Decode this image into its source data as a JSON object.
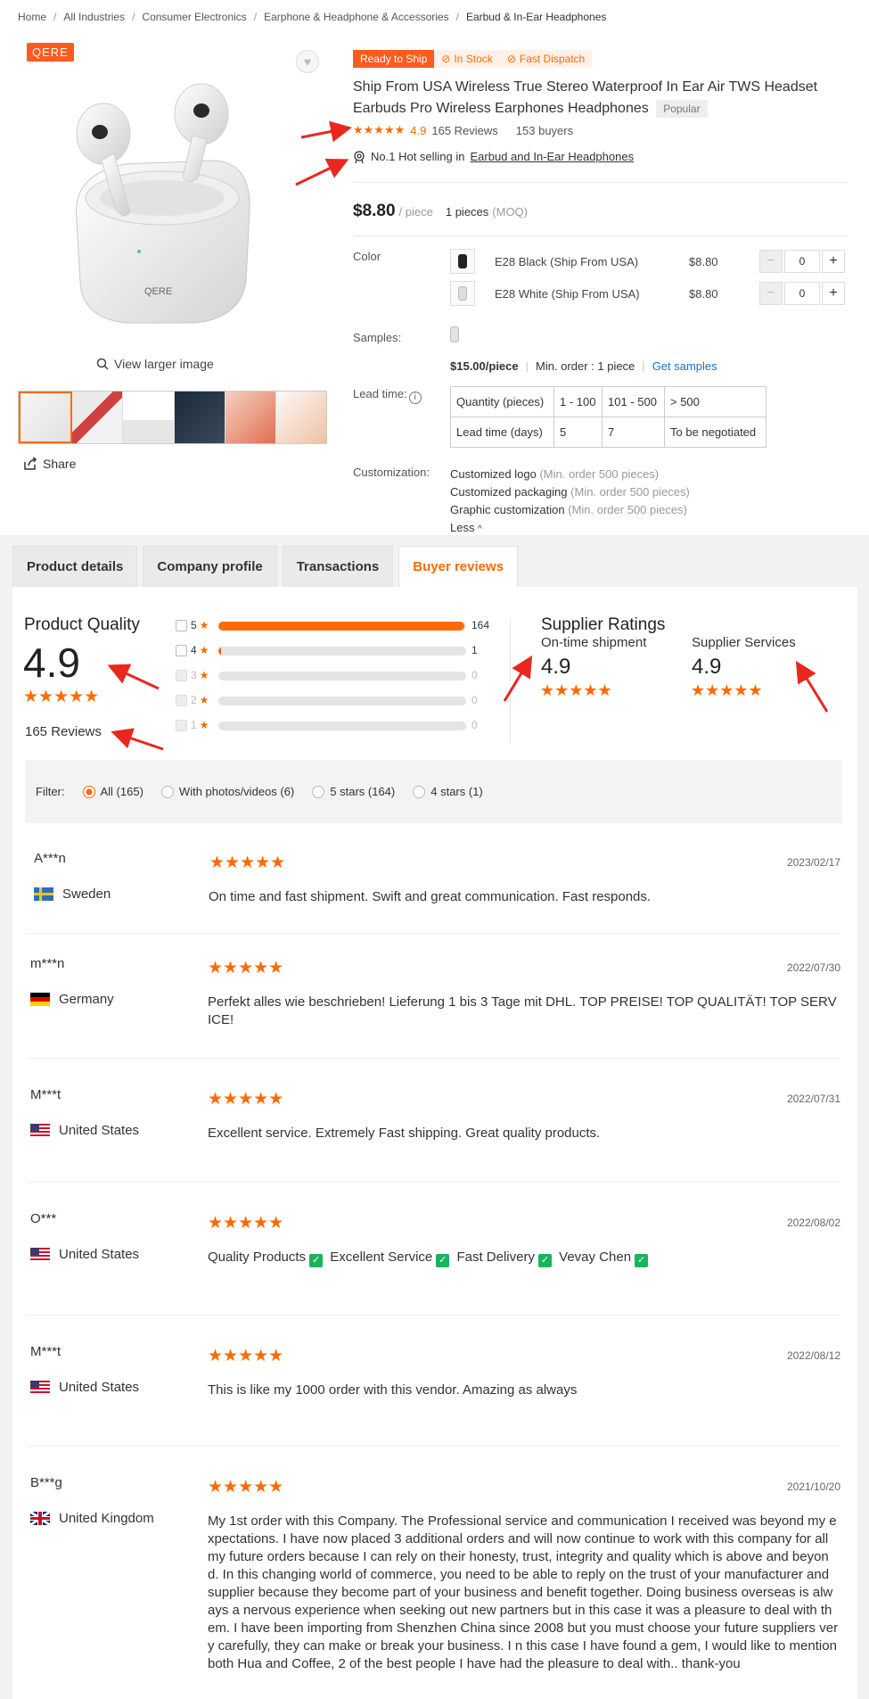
{
  "breadcrumb": [
    "Home",
    "All Industries",
    "Consumer Electronics",
    "Earphone & Headphone & Accessories",
    "Earbud & In-Ear Headphones"
  ],
  "gallery": {
    "brand": "QERE",
    "case_text": "QERE",
    "view_larger": "View larger image",
    "share": "Share"
  },
  "product": {
    "tag_ready": "Ready to Ship",
    "tag_stock": "In Stock",
    "tag_dispatch": "Fast Dispatch",
    "title": "Ship From USA Wireless True Stereo Waterproof In Ear Air TWS Headset Earbuds Pro Wireless Earphones Headphones",
    "popular": "Popular",
    "rating": "4.9",
    "reviews": "165 Reviews",
    "buyers": "153 buyers",
    "hot_prefix": "No.1 Hot selling in",
    "hot_link": "Earbud and In-Ear Headphones",
    "price": "$8.80",
    "price_unit": "/ piece",
    "moq": "1 pieces",
    "moq_label": "(MOQ)"
  },
  "options": {
    "color_label": "Color",
    "variants": [
      {
        "name": "E28 Black (Ship From USA)",
        "price": "$8.80",
        "qty": "0",
        "color": "#222222"
      },
      {
        "name": "E28 White (Ship From USA)",
        "price": "$8.80",
        "qty": "0",
        "color": "#dddddd"
      }
    ],
    "samples_label": "Samples:",
    "sample_price": "$15.00/piece",
    "sample_min": "Min. order : 1 piece",
    "get_samples": "Get samples",
    "lead_label": "Lead time:",
    "lead_table": [
      [
        "Quantity (pieces)",
        "1 - 100",
        "101 - 500",
        "> 500"
      ],
      [
        "Lead time (days)",
        "5",
        "7",
        "To be negotiated"
      ]
    ],
    "custom_label": "Customization:",
    "customizations": [
      {
        "name": "Customized logo",
        "note": "(Min. order 500 pieces)"
      },
      {
        "name": "Customized packaging",
        "note": "(Min. order 500 pieces)"
      },
      {
        "name": "Graphic customization",
        "note": "(Min. order 500 pieces)"
      }
    ],
    "less": "Less"
  },
  "tabs": [
    "Product details",
    "Company profile",
    "Transactions",
    "Buyer reviews"
  ],
  "active_tab": "Buyer reviews",
  "quality": {
    "title": "Product Quality",
    "score": "4.9",
    "reviews": "165 Reviews",
    "distribution": [
      {
        "star": "5",
        "count": "164",
        "fraction": 0.994
      },
      {
        "star": "4",
        "count": "1",
        "fraction": 0.01
      },
      {
        "star": "3",
        "count": "0",
        "fraction": 0
      },
      {
        "star": "2",
        "count": "0",
        "fraction": 0
      },
      {
        "star": "1",
        "count": "0",
        "fraction": 0
      }
    ]
  },
  "supplier": {
    "title": "Supplier Ratings",
    "ontime_label": "On-time shipment",
    "ontime_score": "4.9",
    "services_label": "Supplier Services",
    "services_score": "4.9"
  },
  "filter": {
    "label": "Filter:",
    "options": [
      "All (165)",
      "With photos/videos (6)",
      "5 stars (164)",
      "4 stars (1)"
    ],
    "selected": "All (165)"
  },
  "reviews": [
    {
      "name": "A***n",
      "country": "Sweden",
      "date": "2023/02/17",
      "stars": "★★★★★",
      "text": "On time and fast shipment. Swift and great communication. Fast responds."
    },
    {
      "name": "m***n",
      "country": "Germany",
      "date": "2022/07/30",
      "stars": "★★★★★",
      "text": "Perfekt alles wie beschrieben! Lieferung 1 bis 3 Tage mit DHL. TOP PREISE! TOP QUALITÄT! TOP SERVICE!"
    },
    {
      "name": "M***t",
      "country": "United States",
      "date": "2022/07/31",
      "stars": "★★★★★",
      "text": "Excellent service. Extremely Fast shipping. Great quality products."
    },
    {
      "name": "O***",
      "country": "United States",
      "date": "2022/08/02",
      "stars": "★★★★★",
      "tags": [
        "Quality Products",
        "Excellent Service",
        "Fast Delivery",
        "Vevay Chen"
      ]
    },
    {
      "name": "M***t",
      "country": "United States",
      "date": "2022/08/12",
      "stars": "★★★★★",
      "text": "This is like my 1000 order with this vendor. Amazing as always"
    },
    {
      "name": "B***g",
      "country": "United Kingdom",
      "date": "2021/10/20",
      "stars": "★★★★★",
      "text": "My 1st order with this Company. The Professional service and communication I received was beyond my expectations. I have now placed 3 additional orders and will now continue to work with this company for all my future orders because I can rely on their honesty, trust, integrity and quality which is above and beyond. In this changing world of commerce, you need to be able to reply on the trust of your manufacturer and supplier because they become part of your business and benefit together. Doing business overseas is always a nervous experience when seeking out new partners but in this case it was a pleasure to deal with them. I have been importing from Shenzhen China since 2008 but you must choose your future suppliers very carefully, they can make or break your business. I n this case I have found a gem, I would like to mention both Hua and Coffee, 2 of the best people I have had the pleasure to deal with.. thank-you"
    }
  ],
  "colors": {
    "accent": "#ff6a00",
    "badge": "#ff5a1f",
    "link": "#1a73c8",
    "check": "#1bb35b",
    "arrow": "#e8281e"
  },
  "icons": [
    "heart-icon",
    "search-icon",
    "share-icon",
    "check-circle-icon",
    "badge-icon",
    "info-icon",
    "chevron-up-icon",
    "star-icon",
    "flag-icon",
    "checkbox-icon"
  ]
}
